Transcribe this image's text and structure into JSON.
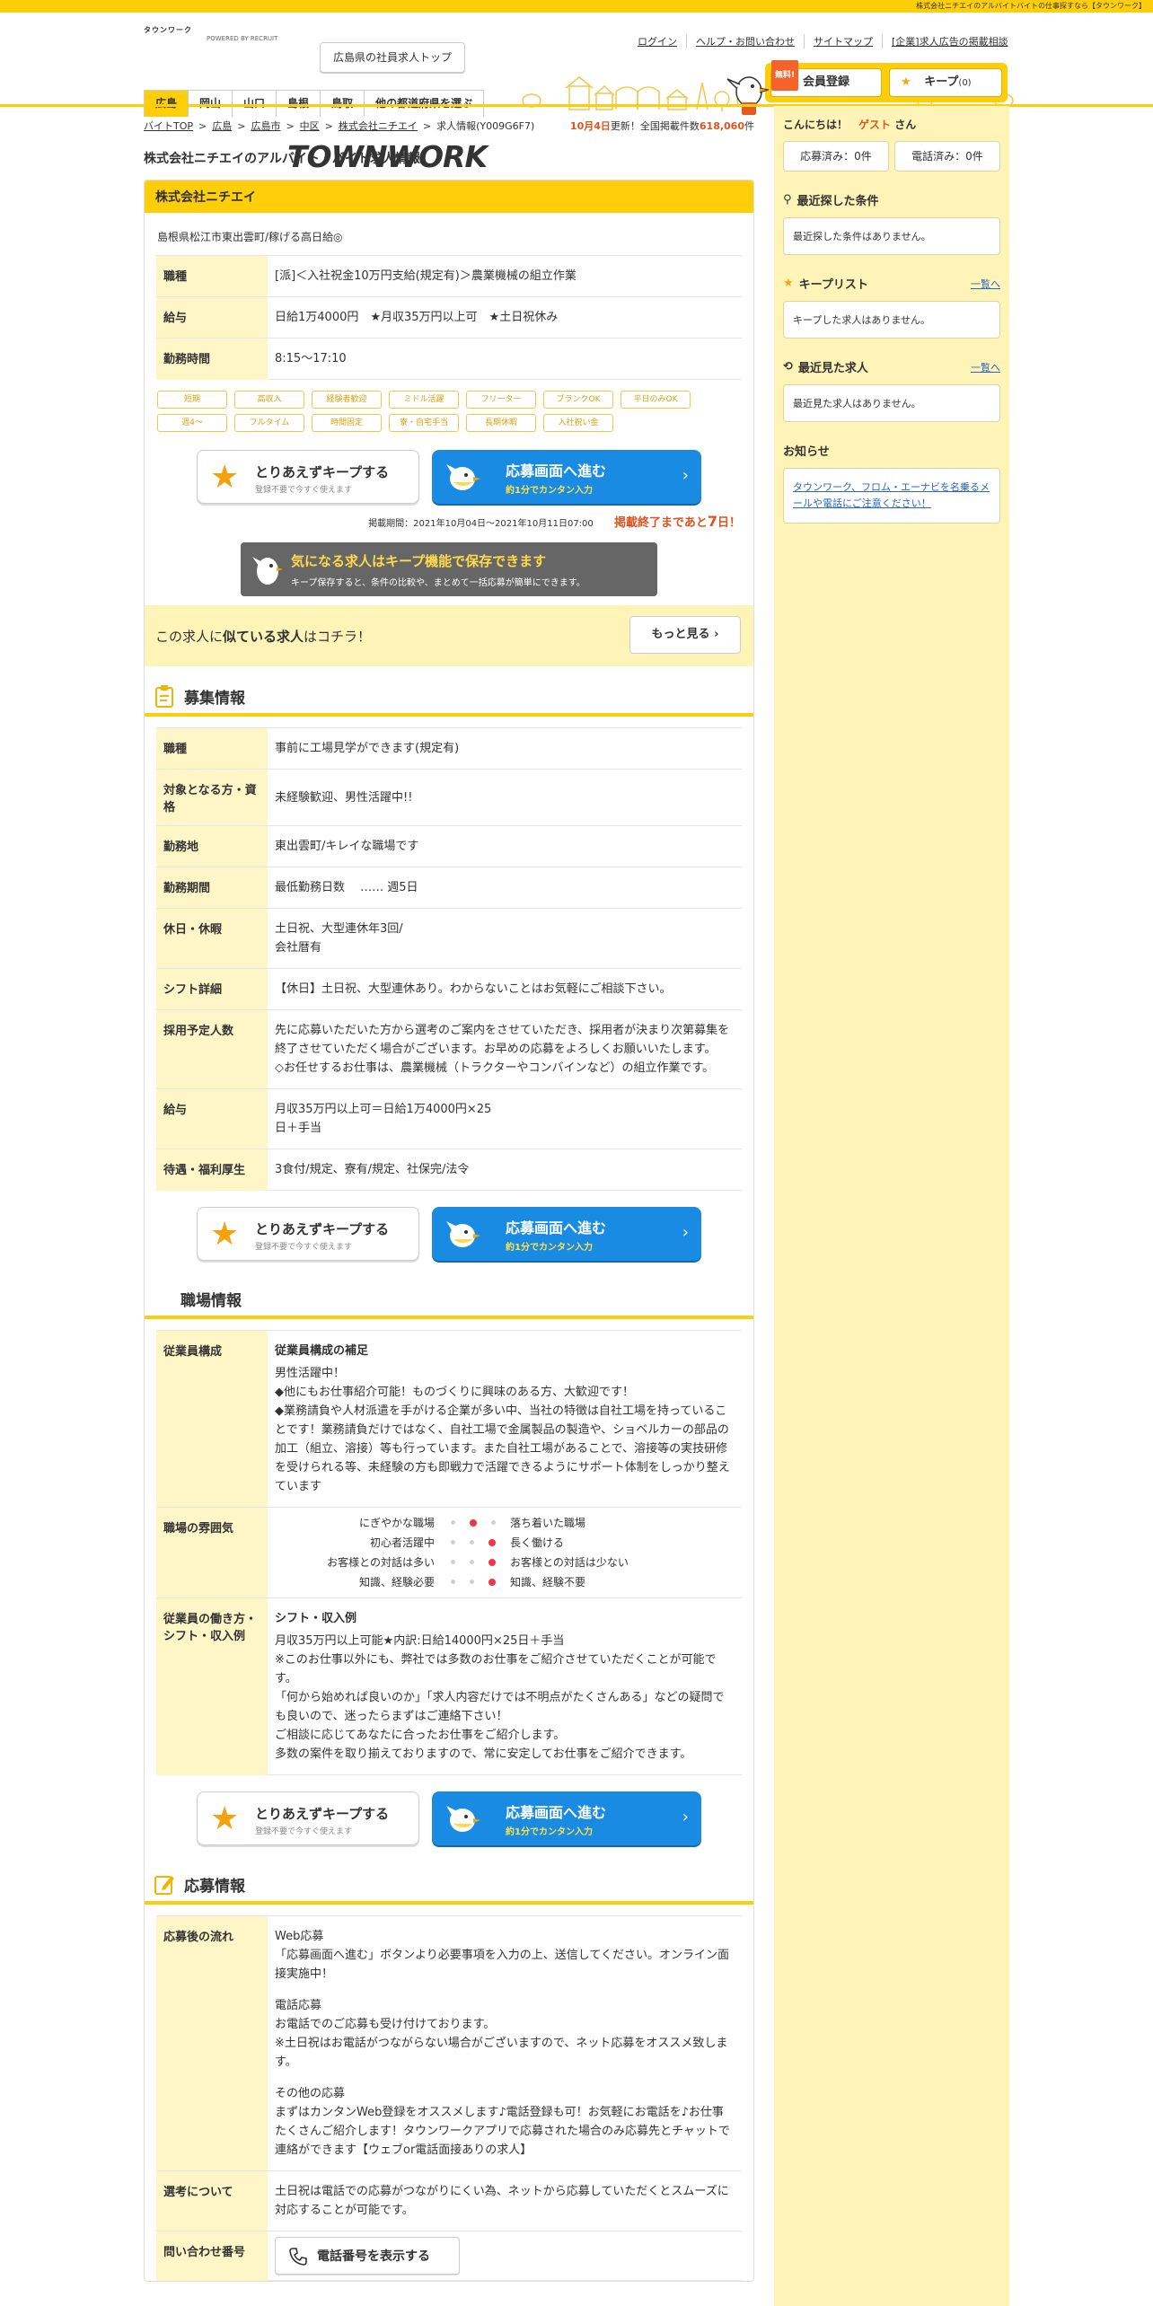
{
  "topbar_text": "株式会社ニチエイのアルバイトバイトの仕事探すなら【タウンワーク】",
  "header": {
    "logo_kana": "タウンワーク",
    "logo_text": "TOWNWORK",
    "logo_sub": "POWERED BY RECRUIT",
    "pref_top_button": "広島県の社員求人トップ",
    "links": [
      "ログイン",
      "ヘルプ・お問い合わせ",
      "サイトマップ",
      "[企業]求人広告の掲載相談"
    ],
    "pref_tabs": [
      "広島",
      "岡山",
      "山口",
      "島根",
      "鳥取",
      "他の都道府県を選ぶ"
    ],
    "free_badge": "無料!",
    "member_button": "会員登録",
    "keep_button": "キープ",
    "keep_count": "(0)"
  },
  "breadcrumb": [
    "バイトTOP",
    "広島",
    "広島市",
    "中区",
    "株式会社ニチエイ",
    "求人情報(Y009G6F7)"
  ],
  "update": {
    "date": "10月4日",
    "mid": "更新！全国掲載件数",
    "count": "618,060",
    "suffix": "件"
  },
  "page_title": "株式会社ニチエイのアルバイト・バイト求人情報",
  "card": {
    "company": "株式会社ニチエイ",
    "lead": "島根県松江市東出雲町/稼げる高日給◎",
    "rows": [
      {
        "th": "職種",
        "td": "[派]＜入社祝金10万円支給(規定有)＞農業機械の組立作業"
      },
      {
        "th": "給与",
        "td": "日給1万4000円　★月収35万円以上可　★土日祝休み"
      },
      {
        "th": "勤務時間",
        "td": "8:15～17:10"
      }
    ],
    "tags": [
      "短期",
      "高収入",
      "経験者歓迎",
      "ミドル活躍",
      "フリーター",
      "ブランクOK",
      "平日のみOK",
      "週4～",
      "フルタイム",
      "時間固定",
      "寮・自宅手当",
      "長期休暇",
      "入社祝い金"
    ]
  },
  "cta": {
    "keep_title": "とりあえずキープする",
    "keep_sub": "登録不要で今すぐ使えます",
    "apply_title": "応募画面へ進む",
    "apply_sub": "約1分でカンタン入力"
  },
  "period": {
    "text": "掲載期間：2021年10月04日～2021年10月11日07:00",
    "remain_pre": "掲載終了まであと",
    "remain_days": "7",
    "remain_post": "日！"
  },
  "keep_banner": {
    "title": "気になる求人はキープ機能で保存できます",
    "sub": "キープ保存すると、条件の比較や、まとめて一括応募が簡単にできます。"
  },
  "similar": {
    "pre": "この求人に",
    "bold": "似ている求人",
    "post": "はコチラ！",
    "more": "もっと見る"
  },
  "recruit": {
    "heading": "募集情報",
    "rows": [
      {
        "th": "職種",
        "td": "事前に工場見学ができます(規定有)"
      },
      {
        "th": "対象となる方・資格",
        "td": "未経験歓迎、男性活躍中!!"
      },
      {
        "th": "勤務地",
        "td": "東出雲町/キレイな職場です"
      },
      {
        "th": "勤務期間",
        "td": "最低勤務日数　 …… 週5日"
      },
      {
        "th": "休日・休暇",
        "td": "土日祝、大型連休年3回/\n会社暦有"
      },
      {
        "th": "シフト詳細",
        "td": "【休日】土日祝、大型連休あり。わからないことはお気軽にご相談下さい。"
      },
      {
        "th": "採用予定人数",
        "td": "先に応募いただいた方から選考のご案内をさせていただき、採用者が決まり次第募集を終了させていただく場合がございます。お早めの応募をよろしくお願いいたします。\n◇お任せするお仕事は、農業機械（トラクターやコンバインなど）の組立作業です。"
      },
      {
        "th": "給与",
        "td": "月収35万円以上可＝日給1万4000円×25\n日＋手当"
      },
      {
        "th": "待遇・福利厚生",
        "td": "3食付/規定、寮有/規定、社保完/法令"
      }
    ]
  },
  "workplace": {
    "heading": "職場情報",
    "staff_th": "従業員構成",
    "staff_sub": "従業員構成の補足",
    "staff_text": "男性活躍中！\n◆他にもお仕事紹介可能！ものづくりに興味のある方、大歓迎です！\n◆業務請負や人材派遣を手がける企業が多い中、当社の特徴は自社工場を持っていることです！業務請負だけではなく、自社工場で金属製品の製造や、ショベルカーの部品の加工（組立、溶接）等も行っています。また自社工場があることで、溶接等の実技研修を受けられる等、未経験の方も即戦力で活躍できるようにサポート体制をしっかり整えています",
    "mood_th": "職場の雰囲気",
    "mood": [
      {
        "left": "にぎやかな職場",
        "right": "落ち着いた職場",
        "level": 2
      },
      {
        "left": "初心者活躍中",
        "right": "長く働ける",
        "level": 3
      },
      {
        "left": "お客様との対話は多い",
        "right": "お客様との対話は少ない",
        "level": 3
      },
      {
        "left": "知識、経験必要",
        "right": "知識、経験不要",
        "level": 3
      }
    ],
    "work_th": "従業員の働き方・シフト・収入例",
    "work_sub": "シフト・収入例",
    "work_text": "月収35万円以上可能★内訳:日給14000円×25日＋手当\n※このお仕事以外にも、弊社では多数のお仕事をご紹介させていただくことが可能です。\n「何から始めれば良いのか」「求人内容だけでは不明点がたくさんある」などの疑問でも良いので、迷ったらまずはご連絡下さい！\nご相談に応じてあなたに合ったお仕事をご紹介します。\n多数の案件を取り揃えておりますので、常に安定してお仕事をご紹介できます。"
  },
  "apply": {
    "heading": "応募情報",
    "flow_th": "応募後の流れ",
    "flow_web_title": "Web応募",
    "flow_web": "「応募画面へ進む」ボタンより必要事項を入力の上、送信してください。オンライン面接実施中！",
    "flow_tel_title": "電話応募",
    "flow_tel": "お電話でのご応募も受け付けております。\n※土日祝はお電話がつながらない場合がございますので、ネット応募をオススメ致します。",
    "flow_other_title": "その他の応募",
    "flow_other": "まずはカンタンWeb登録をオススメします♪電話登録も可！お気軽にお電話を♪お仕事たくさんご紹介します！タウンワークアプリで応募された場合のみ応募先とチャットで連絡ができます【ウェブor電話面接ありの求人】",
    "select_th": "選考について",
    "select_td": "土日祝は電話での応募がつながりにくい為、ネットから応募していただくとスムーズに対応することが可能です。",
    "contact_th": "問い合わせ番号",
    "tel_button": "電話番号を表示する"
  },
  "sidebar": {
    "greet_pre": "こんにちは！",
    "guest": "ゲスト",
    "greet_post": "さん",
    "applied": "応募済み：0件",
    "called": "電話済み：0件",
    "recent_cond_title": "最近探した条件",
    "recent_cond_text": "最近探した条件はありません。",
    "keep_list_title": "キープリスト",
    "keep_list_all": "一覧へ",
    "keep_list_text": "キープした求人はありません。",
    "recent_jobs_title": "最近見た求人",
    "recent_jobs_all": "一覧へ",
    "recent_jobs_text": "最近見た求人はありません。",
    "notice_title": "お知らせ",
    "notice_link": "タウンワーク、フロム・エーナビを名乗るメールや電話にご注意ください！"
  }
}
